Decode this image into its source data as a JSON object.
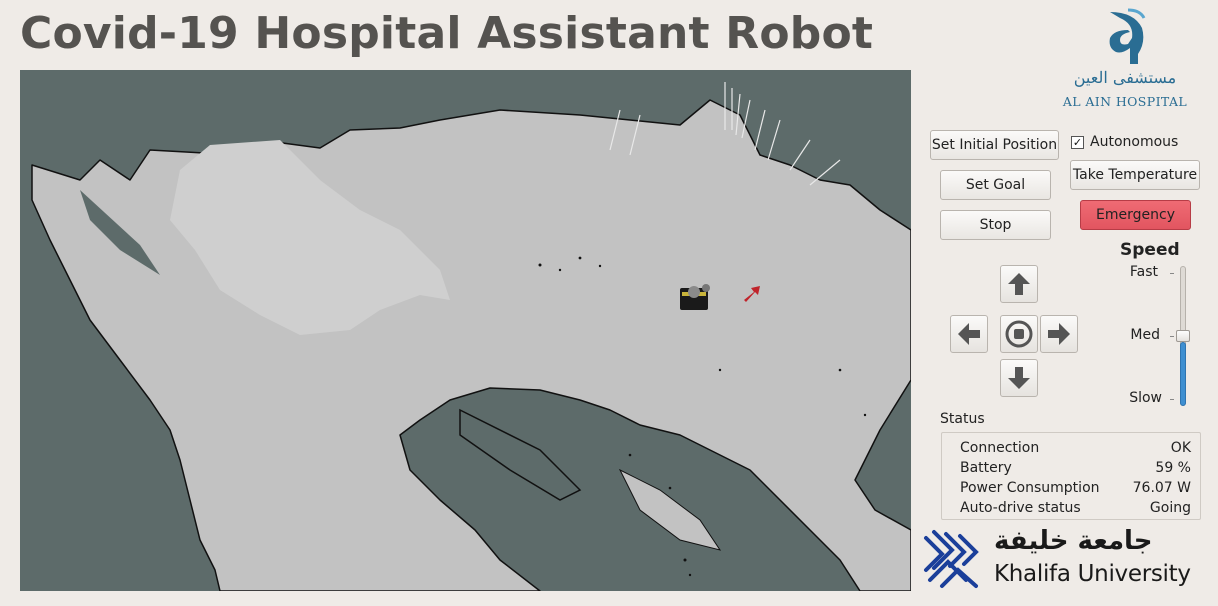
{
  "header": {
    "title": "Covid-19 Hospital Assistant Robot"
  },
  "hospital": {
    "arabic_name": "مستشفى العين",
    "name": "AL AIN HOSPITAL"
  },
  "controls": {
    "set_initial_position": "Set Initial Position",
    "set_goal": "Set Goal",
    "stop": "Stop",
    "autonomous": {
      "label": "Autonomous",
      "checked": true,
      "mark": "✓"
    },
    "take_temperature": "Take Temperature",
    "emergency": "Emergency",
    "emergency_color": "#e85c66"
  },
  "dpad": {
    "up": "arrow-up-icon",
    "down": "arrow-down-icon",
    "left": "arrow-left-icon",
    "right": "arrow-right-icon",
    "center": "stop-circle-icon"
  },
  "speed": {
    "title": "Speed",
    "labels": [
      "Fast",
      "Med",
      "Slow"
    ],
    "level": 0.5,
    "accent": "#3f8fd1"
  },
  "status": {
    "title": "Status",
    "rows": [
      {
        "label": "Connection",
        "value": "OK"
      },
      {
        "label": "Battery",
        "value": "59 %"
      },
      {
        "label": "Power Consumption",
        "value": "76.07 W"
      },
      {
        "label": "Auto-drive status",
        "value": "Going"
      }
    ]
  },
  "university": {
    "arabic_name": "جامعة خليفة",
    "name": "Khalifa University",
    "color": "#1b3f9a"
  }
}
